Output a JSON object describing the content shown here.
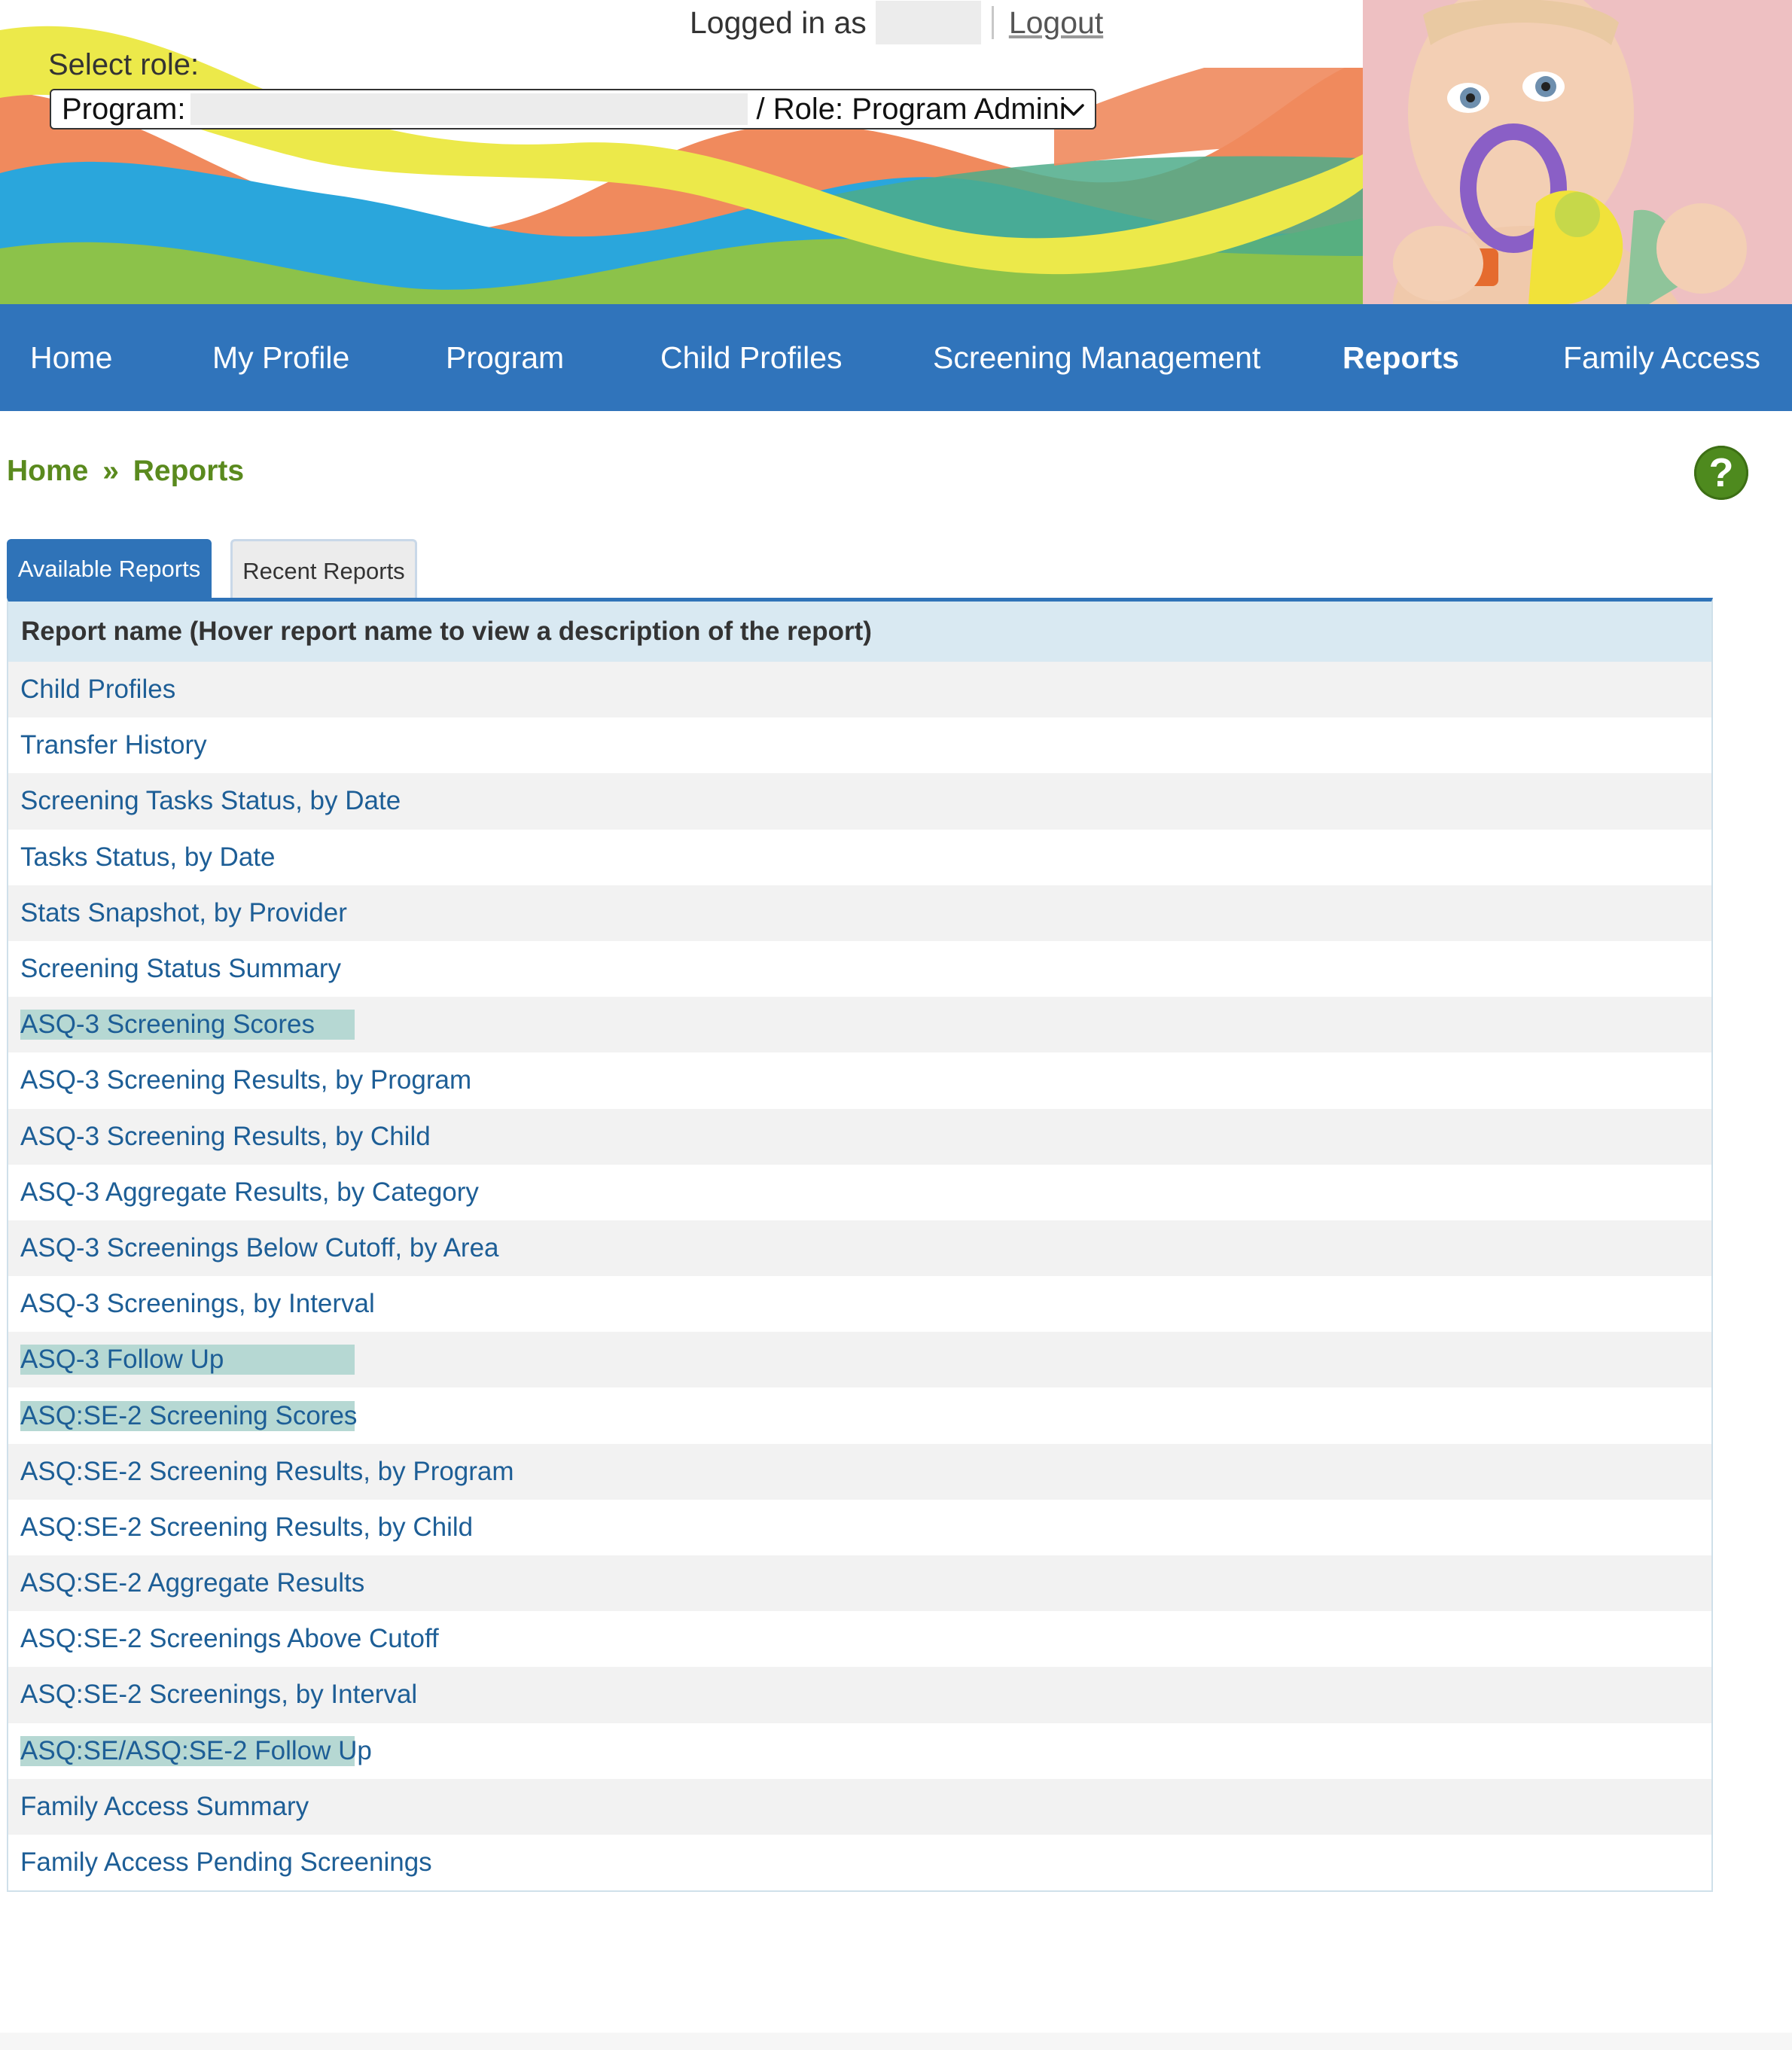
{
  "header": {
    "logged_in_label": "Logged in as",
    "logout_label": "Logout",
    "select_role_label": "Select role:",
    "role_select": {
      "program_prefix": "Program:",
      "role_suffix": "/ Role: Program Admini"
    },
    "banner_colors": [
      "#ece94a",
      "#f08a5d",
      "#2aa6dc",
      "#8cc24a",
      "#4dac8a"
    ]
  },
  "nav": {
    "items": [
      {
        "label": "Home"
      },
      {
        "label": "My Profile"
      },
      {
        "label": "Program"
      },
      {
        "label": "Child Profiles"
      },
      {
        "label": "Screening Management"
      },
      {
        "label": "Reports",
        "active": true
      },
      {
        "label": "Family Access"
      }
    ],
    "background": "#3074bb"
  },
  "breadcrumb": {
    "home": "Home",
    "separator": "»",
    "current": "Reports"
  },
  "help_icon": "question-mark-icon",
  "tabs": [
    {
      "label": "Available Reports",
      "active": true
    },
    {
      "label": "Recent Reports",
      "active": false
    }
  ],
  "table": {
    "header": "Report name (Hover report name to view a description of the report)",
    "rows": [
      {
        "name": "Child Profiles",
        "highlighted": false
      },
      {
        "name": "Transfer History",
        "highlighted": false
      },
      {
        "name": "Screening Tasks Status, by Date",
        "highlighted": false
      },
      {
        "name": "Tasks Status, by Date",
        "highlighted": false
      },
      {
        "name": "Stats Snapshot, by Provider",
        "highlighted": false
      },
      {
        "name": "Screening Status Summary",
        "highlighted": false
      },
      {
        "name": "ASQ-3 Screening Scores",
        "highlighted": true
      },
      {
        "name": "ASQ-3 Screening Results, by Program",
        "highlighted": false
      },
      {
        "name": "ASQ-3 Screening Results, by Child",
        "highlighted": false
      },
      {
        "name": "ASQ-3 Aggregate Results, by Category",
        "highlighted": false
      },
      {
        "name": "ASQ-3 Screenings Below Cutoff, by Area",
        "highlighted": false
      },
      {
        "name": "ASQ-3 Screenings, by Interval",
        "highlighted": false
      },
      {
        "name": "ASQ-3 Follow Up",
        "highlighted": true
      },
      {
        "name": "ASQ:SE-2 Screening Scores",
        "highlighted": true
      },
      {
        "name": "ASQ:SE-2 Screening Results, by Program",
        "highlighted": false
      },
      {
        "name": "ASQ:SE-2 Screening Results, by Child",
        "highlighted": false
      },
      {
        "name": "ASQ:SE-2 Aggregate Results",
        "highlighted": false
      },
      {
        "name": "ASQ:SE-2 Screenings Above Cutoff",
        "highlighted": false
      },
      {
        "name": "ASQ:SE-2 Screenings, by Interval",
        "highlighted": false
      },
      {
        "name": "ASQ:SE/ASQ:SE-2 Follow Up",
        "highlighted": true
      },
      {
        "name": "Family Access Summary",
        "highlighted": false
      },
      {
        "name": "Family Access Pending Screenings",
        "highlighted": false
      }
    ]
  }
}
